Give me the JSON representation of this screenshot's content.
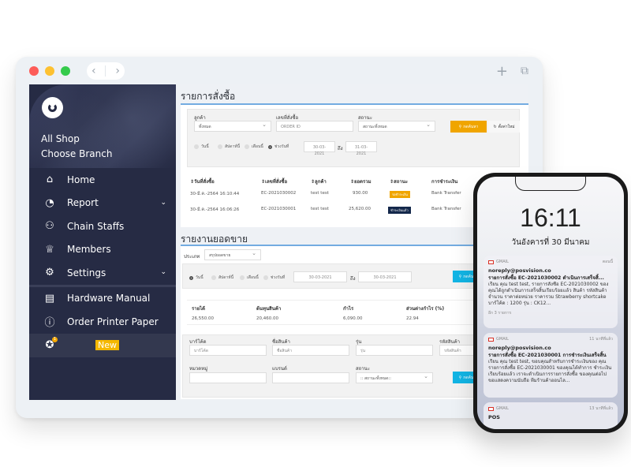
{
  "browser": {
    "nav_back": "‹",
    "nav_forward": "›",
    "new_tab": "+",
    "tabs_overview": "⧉",
    "dot_colors": [
      "#fd5c58",
      "#fdc131",
      "#35cb4c"
    ]
  },
  "sidebar": {
    "shop_name": "All Shop",
    "branch_label": "Choose Branch",
    "items": [
      {
        "label": "Home",
        "icon": "home-icon",
        "glyph": "⌂"
      },
      {
        "label": "Report",
        "icon": "pie-chart-icon",
        "glyph": "◔",
        "chevron": "⌄"
      },
      {
        "label": "Chain Staffs",
        "icon": "staff-icon",
        "glyph": "⚇"
      },
      {
        "label": "Members",
        "icon": "crown-icon",
        "glyph": "♕"
      },
      {
        "label": "Settings",
        "icon": "gear-icon",
        "glyph": "⚙",
        "chevron": "⌄"
      },
      {
        "label": "Hardware Manual",
        "icon": "book-icon",
        "glyph": "▤"
      },
      {
        "label": "Order Printer Paper",
        "icon": "info-icon",
        "glyph": "ⓘ"
      }
    ],
    "new_item": {
      "badge": "New",
      "count": "1",
      "icon": "star-icon",
      "glyph": "✪"
    }
  },
  "orders": {
    "title": "รายการสั่งซื้อ",
    "customer_label": "ลูกค้า",
    "customer_value": "ทั้งหมด",
    "order_no_label": "เลขที่สั่งซื้อ",
    "order_no_placeholder": "ORDER ID",
    "status_label": "สถานะ",
    "status_value": "สถานะทั้งหมด",
    "search_button": "กดค้นหา",
    "reset_button": "ตั้งค่าใหม่",
    "radios": [
      "วันนี้",
      "สัปดาห์นี้",
      "เดือนนี้",
      "ช่วงวันที่"
    ],
    "selected_radio": 3,
    "date_from": "30-03-2021",
    "date_to_label": "ถึง",
    "date_to": "31-03-2021",
    "columns": [
      "วันที่สั่งซื้อ",
      "เลขที่สั่งซื้อ",
      "ลูกค้า",
      "ยอดรวม",
      "สถานะ",
      "การชำระเงิน"
    ],
    "rows": [
      {
        "date": "30-มี.ค.-2564 16:10:44",
        "order_no": "EC-2021030002",
        "customer": "test test",
        "total": "930.00",
        "status": "รอชำระเงิน",
        "status_color": "#f0a500",
        "payment": "Bank Transfer"
      },
      {
        "date": "30-มี.ค.-2564 16:06:26",
        "order_no": "EC-2021030001",
        "customer": "test test",
        "total": "25,620.00",
        "status": "ชำระเงินแล้ว",
        "status_color": "#14284b",
        "payment": "Bank Transfer"
      }
    ]
  },
  "sales": {
    "title": "รายงานยอดขาย",
    "type_label": "ประเภท",
    "type_value": "สรุปยอดขาย",
    "radios": [
      "วันนี้",
      "สัปดาห์นี้",
      "เดือนนี้",
      "ช่วงวันที่"
    ],
    "selected_radio": 0,
    "date_from": "30-03-2021",
    "date_to_label": "ถึง",
    "date_to": "30-03-2021",
    "search_button": "กดค้นหา",
    "columns": [
      "รายได้",
      "ต้นทุนสินค้า",
      "กำไร",
      "ส่วนต่างกำไร (%)"
    ],
    "values": [
      "26,550.00",
      "20,460.00",
      "6,090.00",
      "22.94"
    ]
  },
  "products": {
    "barcode_label": "บาร์โค้ด",
    "barcode_placeholder": "บาร์โค้ด",
    "name_label": "ชื่อสินค้า",
    "name_placeholder": "ชื่อสินค้า",
    "model_label": "รุ่น",
    "model_placeholder": "รุ่น",
    "code_label": "รหัสสินค้า",
    "code_placeholder": "รหัสสินค้า",
    "category_label": "หมวดหมู่",
    "brand_label": "แบรนด์",
    "status_label": "สถานะ",
    "status_value": ":: สถานะทั้งหมด::",
    "search_button": "กดค้นหา"
  },
  "phone": {
    "time": "16:11",
    "date": "วันอังคารที่ 30 มีนาคม",
    "notifications": [
      {
        "app": "GMAIL",
        "when": "ตอนนี้",
        "from": "noreply@posvision.co",
        "subject": "รายการสั่งซื้อ EC-2021030002 ดำเนินการเสร็จสิ้...",
        "body": "เรียน คุณ test test, รายการสั่งซื้อ EC-2021030002 ของคุณได้ถูกดำเนินการเสร็จสิ้นเรียบร้อยแล้ว สินค้า รหัสสินค้า จำนวน ราคาต่อหน่วย ราคารวม Strawberry shortcake บาร์โค้ด : 1200 รุ่น : CK12...",
        "more": "อีก 3 รายการ"
      },
      {
        "app": "GMAIL",
        "when": "11 นาทีที่แล้ว",
        "from": "noreply@posvision.co",
        "subject": "รายการสั่งซื้อ EC-2021030001 การชำระเงินเสร็จสิ้น",
        "body": "เรียน คุณ test test, ขอบคุณสำหรับการชำระเงินของ คุณ รายการสั่งซื้อ EC-2021030001 ของคุณได้ทำการ ชำระเงินเรียบร้อยแล้ว เราจะดำเนินการรายการสั่งซื้อ ของคุณต่อไป ขอแสดงความนับถือ ทีมร้านค้าออนไล..."
      },
      {
        "app": "GMAIL",
        "when": "13 นาทีที่แล้ว",
        "from": "POS"
      }
    ]
  },
  "colors": {
    "sidebar_bg": "#262b44",
    "accent_blue": "#3e8ed8",
    "search_orange": "#f0a500",
    "search_cyan": "#12b5e5",
    "new_badge": "#f5b800"
  }
}
